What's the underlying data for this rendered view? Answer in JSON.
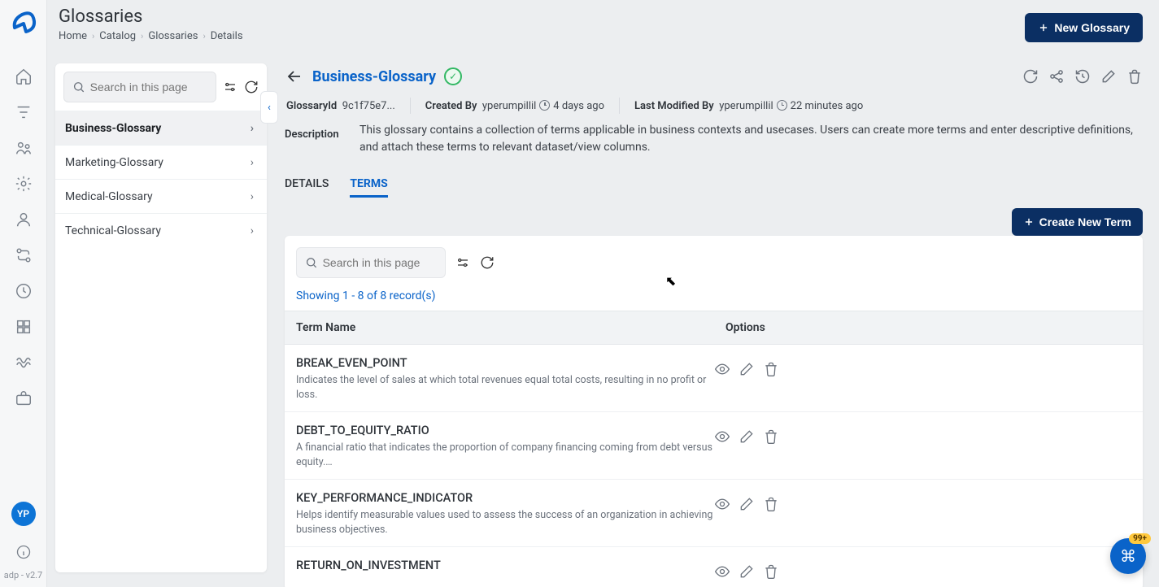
{
  "page": {
    "title": "Glossaries"
  },
  "breadcrumb": [
    "Home",
    "Catalog",
    "Glossaries",
    "Details"
  ],
  "buttons": {
    "new_glossary": "New Glossary",
    "create_term": "Create New Term"
  },
  "sidebar": {
    "search_placeholder": "Search in this page",
    "items": [
      {
        "label": "Business-Glossary",
        "active": true
      },
      {
        "label": "Marketing-Glossary",
        "active": false
      },
      {
        "label": "Medical-Glossary",
        "active": false
      },
      {
        "label": "Technical-Glossary",
        "active": false
      }
    ]
  },
  "detail": {
    "name": "Business-Glossary",
    "meta": {
      "glossary_id_label": "GlossaryId",
      "glossary_id": "9c1f75e7...",
      "created_by_label": "Created By",
      "created_by": "yperumpillil",
      "created_ago": "4 days ago",
      "modified_by_label": "Last Modified By",
      "modified_by": "yperumpillil",
      "modified_ago": "22 minutes ago"
    },
    "description_label": "Description",
    "description": "This glossary contains a collection of terms applicable in business contexts and usecases. Users can create more terms and enter descriptive definitions, and attach these terms to relevant dataset/view columns."
  },
  "tabs": {
    "details": "DETAILS",
    "terms": "TERMS"
  },
  "terms_panel": {
    "search_placeholder": "Search in this page",
    "record_count": "Showing 1 - 8 of 8 record(s)",
    "col_name": "Term Name",
    "col_options": "Options",
    "rows": [
      {
        "name": "BREAK_EVEN_POINT",
        "desc": "Indicates the level of sales at which total revenues equal total costs, resulting in no profit or loss."
      },
      {
        "name": "DEBT_TO_EQUITY_RATIO",
        "desc": "A financial ratio that indicates the proportion of company financing coming from debt versus equity.…"
      },
      {
        "name": "KEY_PERFORMANCE_INDICATOR",
        "desc": "Helps identify measurable values used to assess the success of an organization in achieving business objectives."
      },
      {
        "name": "RETURN_ON_INVESTMENT",
        "desc": ""
      }
    ]
  },
  "rail": {
    "avatar": "YP",
    "version": "adp - v2.7"
  },
  "fab": {
    "badge": "99+"
  }
}
